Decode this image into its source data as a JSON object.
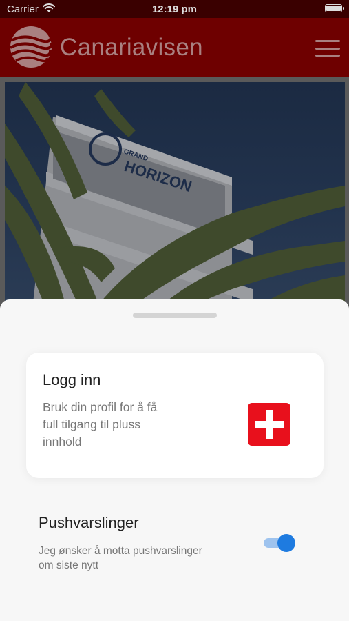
{
  "status_bar": {
    "carrier": "Carrier",
    "time": "12:19 pm"
  },
  "header": {
    "brand": "Canariavisen",
    "menu_icon": "hamburger-menu-icon"
  },
  "hero": {
    "sign_line1": "GRAND",
    "sign_line2": "HORIZON"
  },
  "login_card": {
    "title": "Logg inn",
    "description": "Bruk din profil for å få full tilgang til pluss innhold",
    "icon": "red-cross-icon",
    "icon_color": "#e8101c"
  },
  "push": {
    "title": "Pushvarslinger",
    "description": "Jeg ønsker å motta pushvarslinger om siste nytt",
    "enabled": true,
    "toggle_color": "#1e7be0"
  },
  "colors": {
    "header_bg": "#6e0000",
    "sheet_bg": "#f7f7f7"
  }
}
